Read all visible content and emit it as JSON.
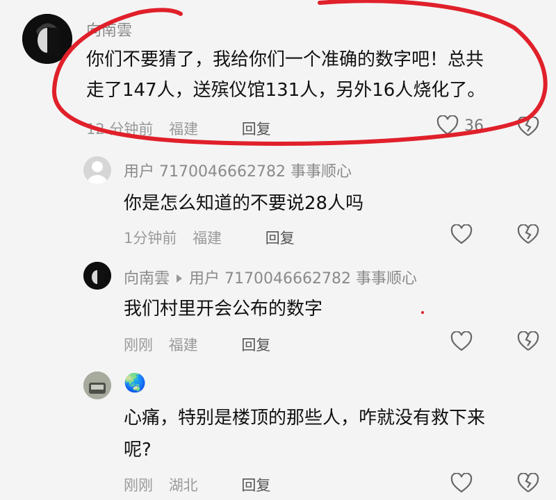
{
  "comments": [
    {
      "username": "向南雲",
      "text_line1": "你们不要猜了，我给你们一个准确的数字吧！总共",
      "text_line2": "走了147人，送殡仪馆131人，另外16人烧化了。",
      "time": "12 分钟前",
      "location": "福建",
      "reply_label": "回复",
      "likes": "36"
    },
    {
      "username": "用户 7170046662782 事事顺心",
      "text": "你是怎么知道的不要说28人吗",
      "time": "1分钟前",
      "location": "福建",
      "reply_label": "回复"
    },
    {
      "username": "向南雲",
      "reply_to": "用户 7170046662782 事事顺心",
      "text": "我们村里开会公布的数字",
      "time": "刚刚",
      "location": "福建",
      "reply_label": "回复"
    },
    {
      "username_emoji": "🌏",
      "text_line1": "心痛，特别是楼顶的那些人，咋就没有救下来",
      "text_line2": "呢?",
      "time": "刚刚",
      "location": "湖北",
      "reply_label": "回复"
    }
  ],
  "colors": {
    "annotation_red": "#e0202a",
    "meta_gray": "#9a9a9a"
  },
  "icons": [
    "avatar",
    "heart-icon",
    "broken-heart-icon",
    "arrow-icon"
  ]
}
